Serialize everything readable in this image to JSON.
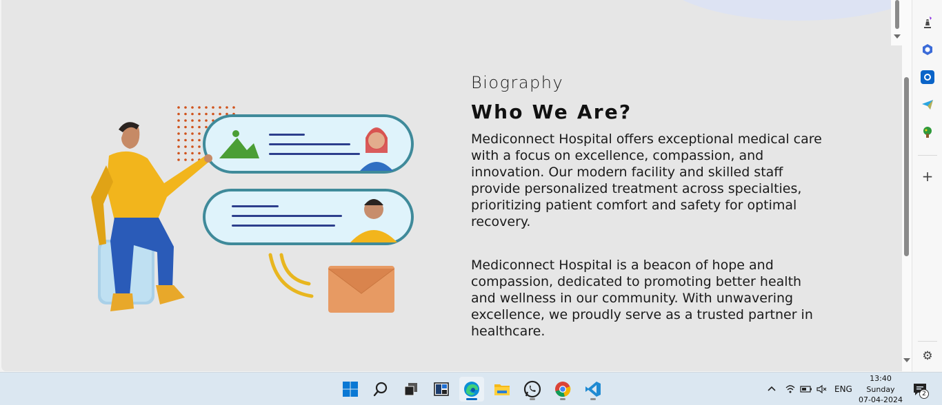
{
  "page": {
    "eyebrow": "Biography",
    "heading": "Who We Are?",
    "paragraphs": [
      "Mediconnect Hospital offers exceptional medical care with a focus on excellence, compassion, and innovation. Our modern facility and skilled staff provide personalized treatment across specialties, prioritizing patient comfort and safety for optimal recovery.",
      "Mediconnect Hospital is a beacon of hope and compassion, dedicated to promoting better health and wellness in our community. With unwavering excellence, we proudly serve as a trusted partner in healthcare."
    ]
  },
  "sidebar": {
    "icons": [
      "chess-icon",
      "copilot-icon",
      "outlook-icon",
      "telegram-icon",
      "games-icon"
    ],
    "add_label": "+",
    "settings_icon": "gear-icon"
  },
  "taskbar": {
    "apps": [
      {
        "name": "start-button",
        "icon": "windows-icon"
      },
      {
        "name": "search-button",
        "icon": "search-icon"
      },
      {
        "name": "task-view-button",
        "icon": "task-view-icon"
      },
      {
        "name": "widgets-button",
        "icon": "widgets-icon"
      },
      {
        "name": "edge-app",
        "icon": "edge-icon",
        "active": true
      },
      {
        "name": "file-explorer-app",
        "icon": "folder-icon"
      },
      {
        "name": "whatsapp-app",
        "icon": "whatsapp-icon"
      },
      {
        "name": "chrome-app",
        "icon": "chrome-icon"
      },
      {
        "name": "vscode-app",
        "icon": "vscode-icon"
      }
    ],
    "language": "ENG",
    "time": "13:40",
    "day": "Sunday",
    "date": "07-04-2024",
    "notification_count": "2"
  },
  "colors": {
    "page_bg": "#e6e6e6",
    "taskbar_bg": "#dbe7f1",
    "shirt": "#f2b51c",
    "pants": "#2a5bb8",
    "envelope": "#e79a63"
  }
}
